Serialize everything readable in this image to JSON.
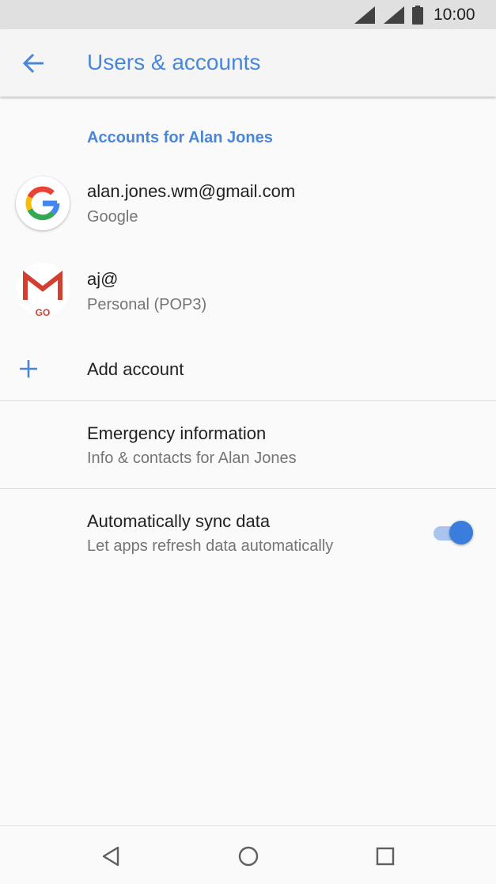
{
  "status_bar": {
    "time": "10:00",
    "icons": [
      "signal-icon",
      "signal-icon",
      "battery-icon"
    ]
  },
  "app_bar": {
    "title": "Users & accounts",
    "back_icon": "arrow-back-icon"
  },
  "accounts_section": {
    "header": "Accounts for Alan Jones",
    "accounts": [
      {
        "title": "alan.jones.wm@gmail.com",
        "subtitle": "Google",
        "icon": "google-icon"
      },
      {
        "title": "aj@",
        "subtitle": "Personal (POP3)",
        "icon": "gmail-go-icon",
        "icon_text": "GO"
      }
    ],
    "add_account": {
      "label": "Add account",
      "icon": "plus-icon"
    }
  },
  "emergency": {
    "title": "Emergency information",
    "subtitle": "Info & contacts for Alan Jones"
  },
  "sync": {
    "title": "Automatically sync data",
    "subtitle": "Let apps refresh data automatically",
    "enabled": true
  },
  "nav_bar": {
    "icons": [
      "back-triangle-icon",
      "home-circle-icon",
      "recents-square-icon"
    ]
  },
  "colors": {
    "accent": "#4a86d8",
    "toggle_on": "#3b7ddd",
    "status_bar": "#e0e0e0",
    "background": "#fafafa"
  }
}
